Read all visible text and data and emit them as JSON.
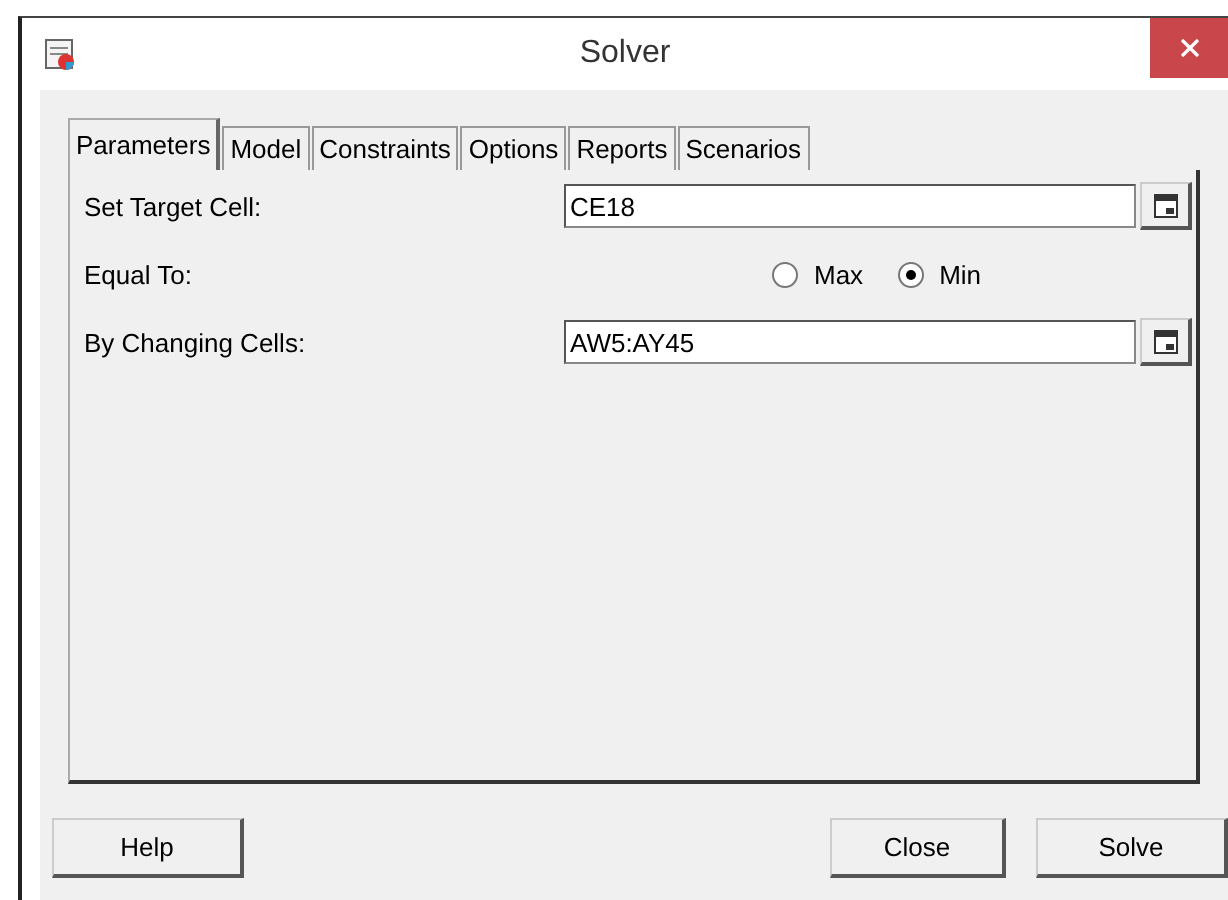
{
  "window": {
    "title": "Solver"
  },
  "tabs": [
    {
      "label": "Parameters",
      "selected": true
    },
    {
      "label": "Model",
      "selected": false
    },
    {
      "label": "Constraints",
      "selected": false
    },
    {
      "label": "Options",
      "selected": false
    },
    {
      "label": "Reports",
      "selected": false
    },
    {
      "label": "Scenarios",
      "selected": false
    }
  ],
  "parameters": [
    {
      "kind": "field",
      "label": "Set Target Cell:",
      "value": "CE18"
    },
    {
      "kind": "radios",
      "label": "Equal To:",
      "options": [
        {
          "label": "Max",
          "selected": false
        },
        {
          "label": "Min",
          "selected": true
        }
      ]
    },
    {
      "kind": "field",
      "label": "By Changing Cells:",
      "value": "AW5:AY45"
    }
  ],
  "buttons_left": [
    "Help"
  ],
  "buttons_right": [
    "Close",
    "Solve"
  ]
}
